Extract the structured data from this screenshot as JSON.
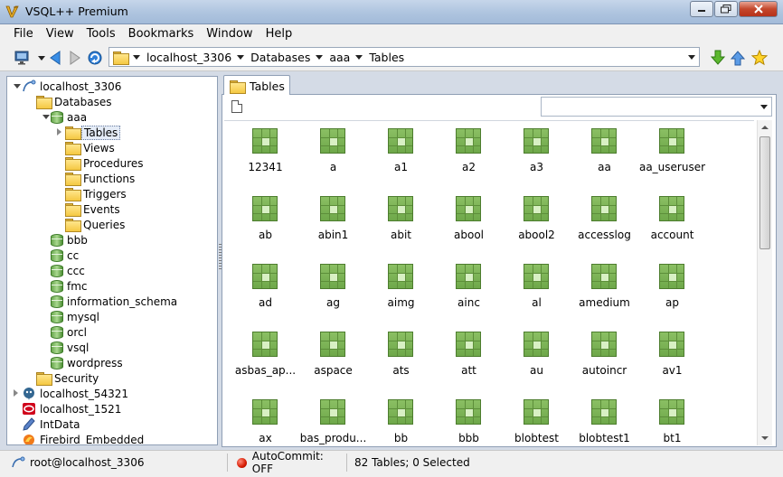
{
  "window": {
    "title": "VSQL++ Premium"
  },
  "menu": [
    "File",
    "View",
    "Tools",
    "Bookmarks",
    "Window",
    "Help"
  ],
  "path": {
    "segments": [
      "localhost_3306",
      "Databases",
      "aaa",
      "Tables"
    ]
  },
  "tree": {
    "items": [
      {
        "label": "localhost_3306",
        "icon": "connection-icon",
        "level": 0,
        "expander": "open"
      },
      {
        "label": "Databases",
        "icon": "folder-icon",
        "level": 1,
        "expander": "none"
      },
      {
        "label": "aaa",
        "icon": "database-icon",
        "level": 2,
        "expander": "open"
      },
      {
        "label": "Tables",
        "icon": "folder-icon",
        "level": 3,
        "expander": "closed",
        "selected": true
      },
      {
        "label": "Views",
        "icon": "folder-icon",
        "level": 3,
        "expander": "none"
      },
      {
        "label": "Procedures",
        "icon": "folder-icon",
        "level": 3,
        "expander": "none"
      },
      {
        "label": "Functions",
        "icon": "folder-icon",
        "level": 3,
        "expander": "none"
      },
      {
        "label": "Triggers",
        "icon": "folder-icon",
        "level": 3,
        "expander": "none"
      },
      {
        "label": "Events",
        "icon": "folder-icon",
        "level": 3,
        "expander": "none"
      },
      {
        "label": "Queries",
        "icon": "folder-icon",
        "level": 3,
        "expander": "none"
      },
      {
        "label": "bbb",
        "icon": "database-icon",
        "level": 2,
        "expander": "none"
      },
      {
        "label": "cc",
        "icon": "database-icon",
        "level": 2,
        "expander": "none"
      },
      {
        "label": "ccc",
        "icon": "database-icon",
        "level": 2,
        "expander": "none"
      },
      {
        "label": "fmc",
        "icon": "database-icon",
        "level": 2,
        "expander": "none"
      },
      {
        "label": "information_schema",
        "icon": "database-icon",
        "level": 2,
        "expander": "none"
      },
      {
        "label": "mysql",
        "icon": "database-icon",
        "level": 2,
        "expander": "none"
      },
      {
        "label": "orcl",
        "icon": "database-icon",
        "level": 2,
        "expander": "none"
      },
      {
        "label": "vsql",
        "icon": "database-icon",
        "level": 2,
        "expander": "none"
      },
      {
        "label": "wordpress",
        "icon": "database-icon",
        "level": 2,
        "expander": "none"
      },
      {
        "label": "Security",
        "icon": "folder-icon",
        "level": 1,
        "expander": "none"
      },
      {
        "label": "localhost_54321",
        "icon": "postgres-icon",
        "level": 0,
        "expander": "closed"
      },
      {
        "label": "localhost_1521",
        "icon": "oracle-icon",
        "level": 0,
        "expander": "none"
      },
      {
        "label": "IntData",
        "icon": "interbase-icon",
        "level": 0,
        "expander": "none"
      },
      {
        "label": "Firebird_Embedded",
        "icon": "firebird-icon",
        "level": 0,
        "expander": "none"
      }
    ]
  },
  "tab": {
    "label": "Tables"
  },
  "filter": {
    "value": ""
  },
  "tables": [
    "12341",
    "a",
    "a1",
    "a2",
    "a3",
    "aa",
    "aa_useruser",
    "ab",
    "abin1",
    "abit",
    "abool",
    "abool2",
    "accesslog",
    "account",
    "ad",
    "ag",
    "aimg",
    "ainc",
    "al",
    "amedium",
    "ap",
    "asbas_ap...",
    "aspace",
    "ats",
    "att",
    "au",
    "autoincr",
    "av1",
    "ax",
    "bas_produ...",
    "bb",
    "bbb",
    "blobtest",
    "blobtest1",
    "bt1"
  ],
  "status": {
    "connection": "root@localhost_3306",
    "autocommit": "AutoCommit: OFF",
    "summary": "82 Tables;  0 Selected"
  }
}
